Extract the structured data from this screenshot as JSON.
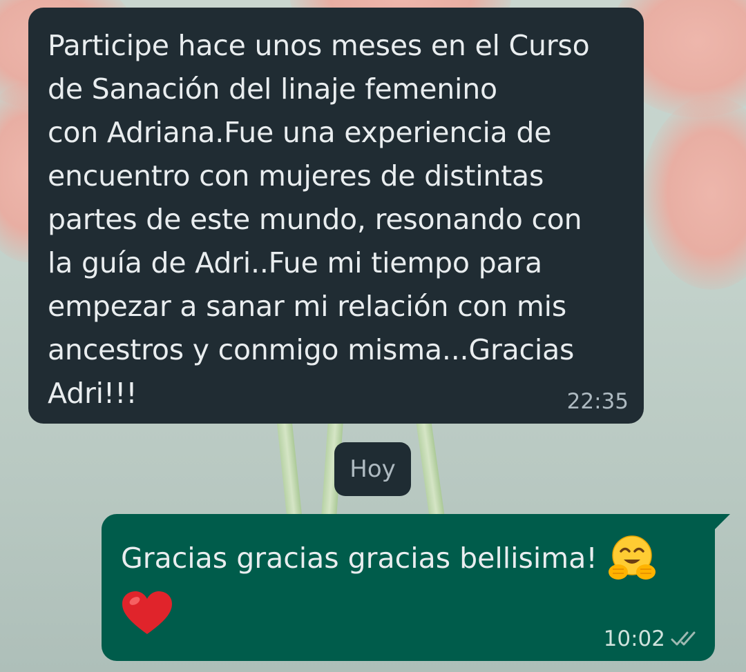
{
  "chat": {
    "incoming": {
      "text": "Participe hace unos meses en el Curso\nde Sanación del linaje femenino\ncon Adriana.Fue una experiencia de\nencuentro con mujeres de distintas\npartes de este mundo, resonando con\nla guía de Adri..Fue mi tiempo para\nempezar a sanar mi relación con mis\nancestros y conmigo misma...Gracias\nAdri!!!",
      "time": "22:35"
    },
    "date_separator": "Hoy",
    "outgoing": {
      "text": "Gracias gracias gracias bellisima!",
      "emoji_1": "hugging-face-emoji",
      "emoji_2": "red-heart-emoji",
      "time": "10:02",
      "status_icon": "double-check-icon"
    }
  },
  "colors": {
    "incoming_bubble": "#202c33",
    "outgoing_bubble": "#005c4b",
    "text": "#e9edef",
    "meta_text": "#aebac1"
  }
}
